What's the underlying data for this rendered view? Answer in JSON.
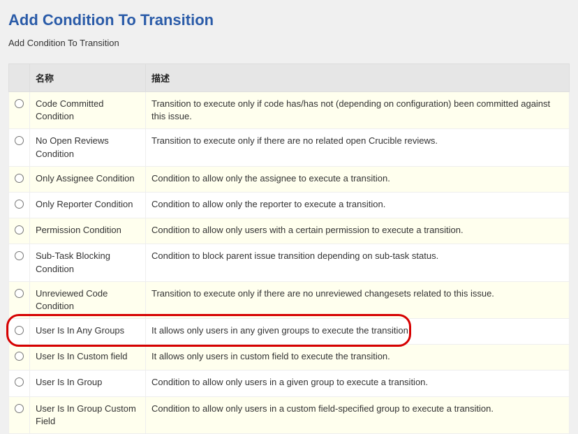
{
  "header": {
    "title": "Add Condition To Transition",
    "subtitle": "Add Condition To Transition"
  },
  "table": {
    "headers": {
      "name": "名称",
      "description": "描述"
    },
    "rows": [
      {
        "name": "Code Committed Condition",
        "description": "Transition to execute only if code has/has not (depending on configuration) been committed against this issue."
      },
      {
        "name": "No Open Reviews Condition",
        "description": "Transition to execute only if there are no related open Crucible reviews."
      },
      {
        "name": "Only Assignee Condition",
        "description": "Condition to allow only the assignee to execute a transition."
      },
      {
        "name": "Only Reporter Condition",
        "description": "Condition to allow only the reporter to execute a transition."
      },
      {
        "name": "Permission Condition",
        "description": "Condition to allow only users with a certain permission to execute a transition."
      },
      {
        "name": "Sub-Task Blocking Condition",
        "description": "Condition to block parent issue transition depending on sub-task status."
      },
      {
        "name": "Unreviewed Code Condition",
        "description": "Transition to execute only if there are no unreviewed changesets related to this issue."
      },
      {
        "name": "User Is In Any Groups",
        "description": "It allows only users in any given groups to execute the transition."
      },
      {
        "name": "User Is In Custom field",
        "description": "It allows only users in custom field to execute the transition."
      },
      {
        "name": "User Is In Group",
        "description": "Condition to allow only users in a given group to execute a transition."
      },
      {
        "name": "User Is In Group Custom Field",
        "description": "Condition to allow only users in a custom field-specified group to execute a transition."
      }
    ]
  },
  "highlight": {
    "row_index": 7,
    "color": "#d60000"
  }
}
